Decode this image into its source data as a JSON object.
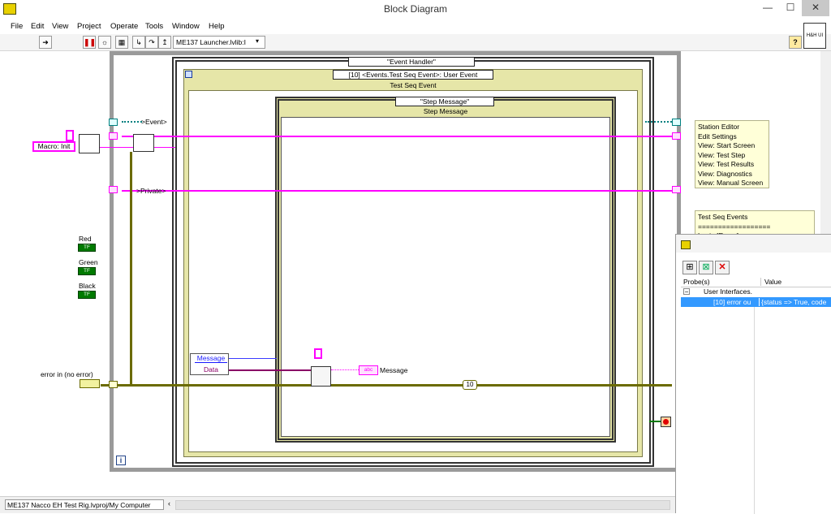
{
  "window": {
    "title": "Block Diagram",
    "min": "—",
    "max": "☐",
    "close": "✕"
  },
  "menus": [
    "File",
    "Edit",
    "View",
    "Project",
    "Operate",
    "Tools",
    "Window",
    "Help"
  ],
  "toolbar": {
    "vi_path": "ME137 Launcher.lvlib:I",
    "help_label": "?",
    "icon_label": "H&H UI"
  },
  "diagram": {
    "event_label": ">Event>",
    "private_label": ">Private>",
    "macro_const": "Macro: Init",
    "red": "Red",
    "green": "Green",
    "black": "Black",
    "tf": "TF",
    "error_in": "error in (no error)",
    "outer_case": "\"Event Handler\"",
    "event_selector": "[10] <Events.Test Seq Event>: User Event",
    "event_title": "Test Seq Event",
    "inner_case": "\"Step Message\"",
    "inner_title": "Step Message",
    "unbundle": [
      "Message",
      "Data"
    ],
    "message_indicator": "abc",
    "message_label": "Message",
    "probe_number": "10",
    "info": "i"
  },
  "notes": {
    "station": [
      "Station Editor",
      "Edit Settings",
      "View: Start Screen",
      "View: Test Step",
      "View: Test Results",
      "View: Diagnostics",
      "View: Manual Screen"
    ],
    "testseq": [
      "Test Seq Events",
      "==================",
      "Login [Enum]"
    ]
  },
  "status": {
    "project": "ME137 Nacco EH Test Rig.lvproj/My Computer"
  },
  "probe": {
    "columns": [
      "Probe(s)",
      "Value"
    ],
    "group": "User Interfaces.",
    "row_name": "[10] error ou",
    "row_value": "{status => True, code"
  },
  "colors": {
    "string_wire": "#ff00ff",
    "error_wire": "#6b6b00",
    "case_frame": "#e6e6a8",
    "selection": "#3399ff"
  }
}
